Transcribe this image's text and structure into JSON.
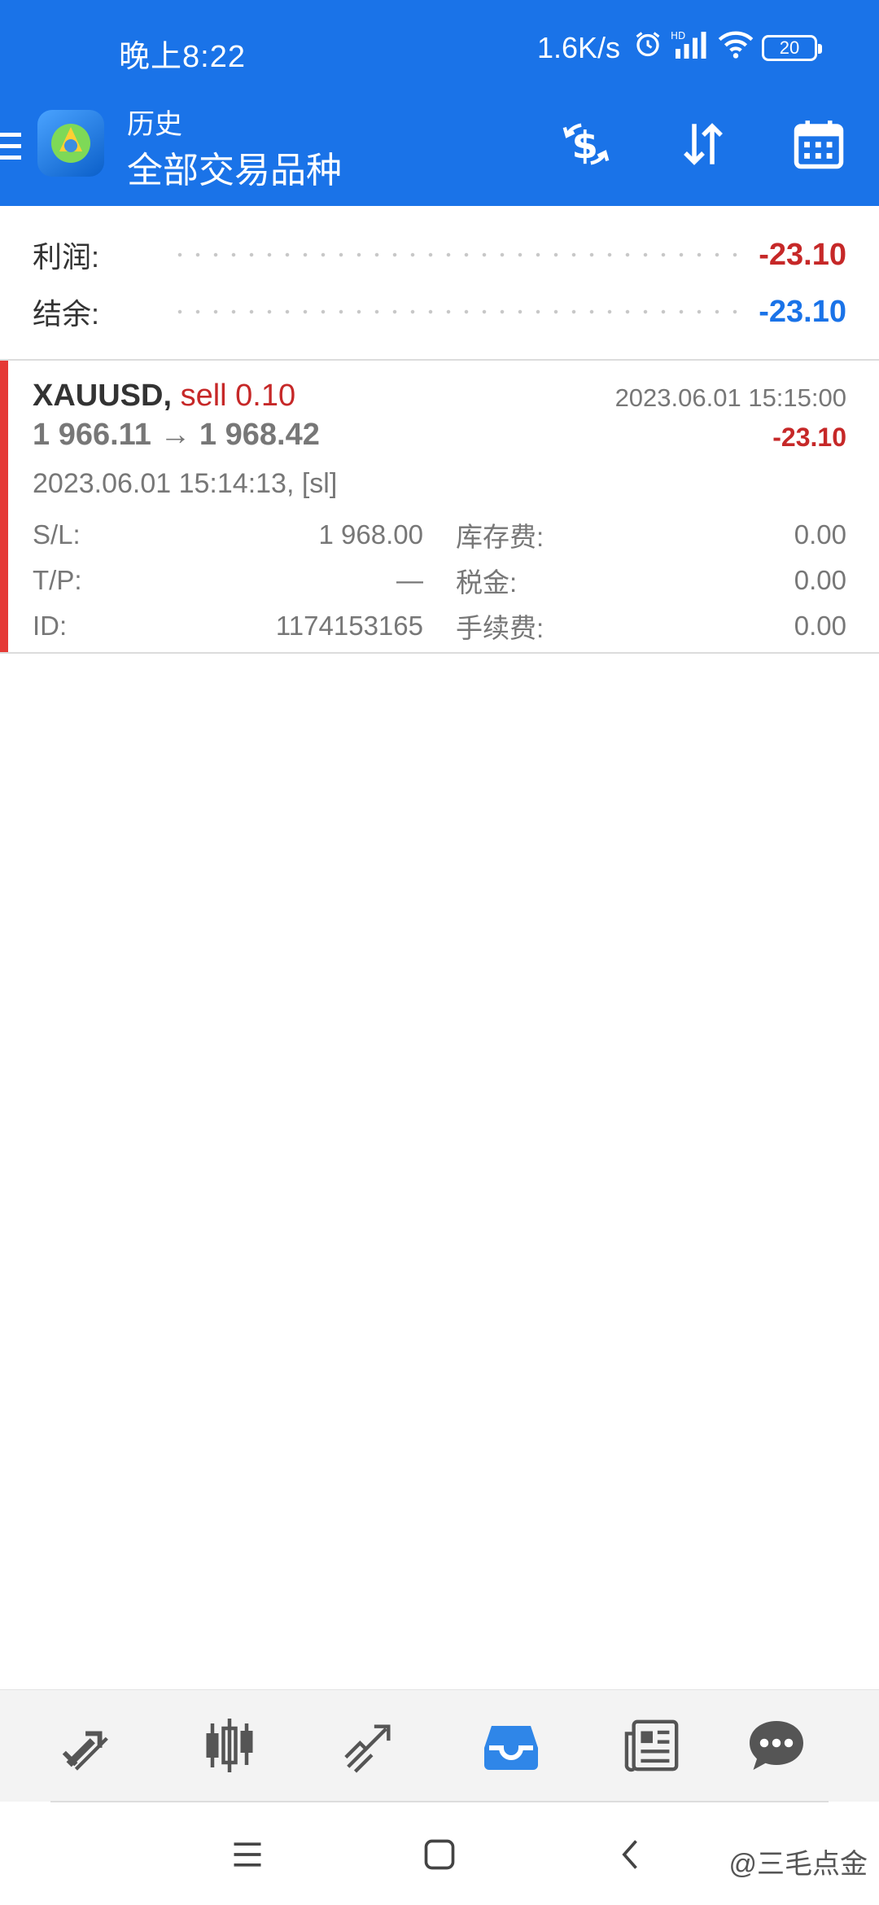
{
  "status_bar": {
    "time": "晚上8:22",
    "net_speed": "1.6K/s",
    "battery": "20"
  },
  "app_bar": {
    "subtitle": "历史",
    "title": "全部交易品种"
  },
  "summary": {
    "profit_label": "利润:",
    "profit_value": "-23.10",
    "balance_label": "结余:",
    "balance_value": "-23.10"
  },
  "trade": {
    "symbol": "XAUUSD,",
    "side": "sell 0.10",
    "close_time": "2023.06.01 15:15:00",
    "prices": "1 966.11 → 1 968.42",
    "profit": "-23.10",
    "open_info": "2023.06.01 15:14:13, [sl]",
    "rows": [
      {
        "l1": "S/L:",
        "v1": "1 968.00",
        "l2": "库存费:",
        "v2": "0.00"
      },
      {
        "l1": "T/P:",
        "v1": "—",
        "l2": "税金:",
        "v2": "0.00"
      },
      {
        "l1": "ID:",
        "v1": "1174153165",
        "l2": "手续费:",
        "v2": "0.00"
      }
    ]
  },
  "watermark": "@三毛点金",
  "colors": {
    "primary": "#1a73e8",
    "loss": "#c62828",
    "marker": "#e53935"
  }
}
